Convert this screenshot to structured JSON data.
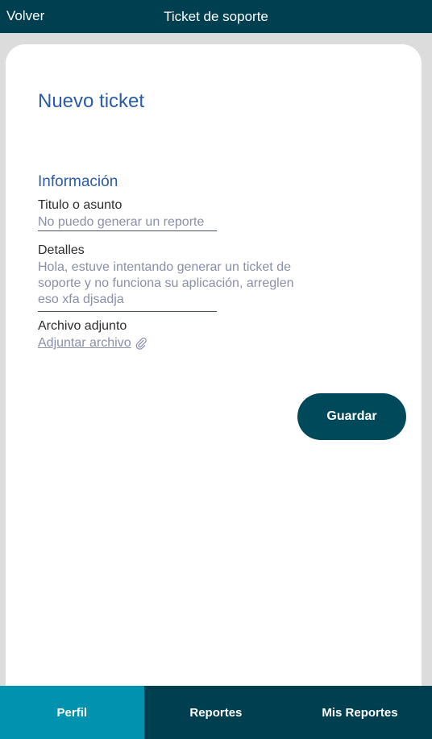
{
  "header": {
    "back_label": "Volver",
    "title": "Ticket de soporte"
  },
  "form": {
    "page_title": "Nuevo ticket",
    "section_title": "Información",
    "title_label": "Titulo o asunto",
    "title_value": "No puedo generar un reporte",
    "details_label": "Detalles",
    "details_value": "Hola, estuve intentando generar un ticket de soporte y no funciona su aplicación, arreglen eso xfa djsadja",
    "attachment_label": "Archivo adjunto",
    "attachment_link": "Adjuntar archivo",
    "attachment_icon": "paperclip-icon",
    "save_label": "Guardar"
  },
  "bottom_nav": {
    "items": [
      {
        "label": "Perfil",
        "active": true
      },
      {
        "label": "Reportes",
        "active": false
      },
      {
        "label": "Mis Reportes",
        "active": false
      }
    ]
  },
  "colors": {
    "header_bg": "#003f50",
    "accent_title": "#2a5ca8",
    "button_bg": "#00495a",
    "nav_active": "#0092ae"
  }
}
